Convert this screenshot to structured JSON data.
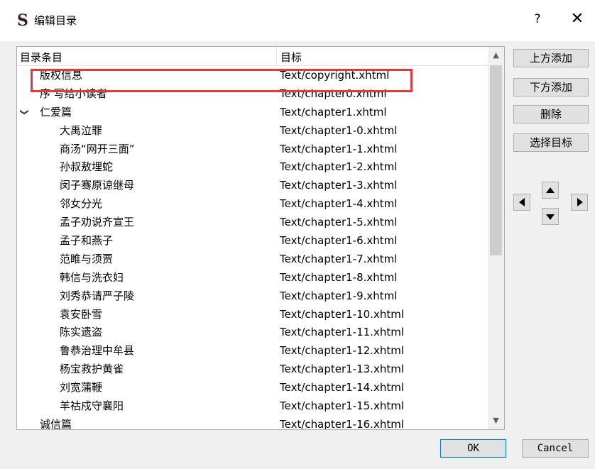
{
  "window": {
    "title": "编辑目录",
    "app_icon": "S",
    "help_label": "?",
    "close_label": "✕"
  },
  "tree": {
    "columns": [
      "目录条目",
      "目标"
    ],
    "rows": [
      {
        "name": "版权信息",
        "target": "Text/copyright.xhtml",
        "level": 0
      },
      {
        "name": "序 写给小读者",
        "target": "Text/chapter0.xhtml",
        "level": 0
      },
      {
        "name": "仁爱篇",
        "target": "Text/chapter1.xhtml",
        "level": 0,
        "expanded": true
      },
      {
        "name": "大禹泣罪",
        "target": "Text/chapter1-0.xhtml",
        "level": 1
      },
      {
        "name": "商汤“网开三面”",
        "target": "Text/chapter1-1.xhtml",
        "level": 1
      },
      {
        "name": "孙叔敖埋蛇",
        "target": "Text/chapter1-2.xhtml",
        "level": 1
      },
      {
        "name": "闵子骞原谅继母",
        "target": "Text/chapter1-3.xhtml",
        "level": 1
      },
      {
        "name": "邻女分光",
        "target": "Text/chapter1-4.xhtml",
        "level": 1
      },
      {
        "name": "孟子劝说齐宣王",
        "target": "Text/chapter1-5.xhtml",
        "level": 1
      },
      {
        "name": "孟子和燕子",
        "target": "Text/chapter1-6.xhtml",
        "level": 1
      },
      {
        "name": "范睢与须贾",
        "target": "Text/chapter1-7.xhtml",
        "level": 1
      },
      {
        "name": "韩信与洗衣妇",
        "target": "Text/chapter1-8.xhtml",
        "level": 1
      },
      {
        "name": "刘秀恭请严子陵",
        "target": "Text/chapter1-9.xhtml",
        "level": 1
      },
      {
        "name": "袁安卧雪",
        "target": "Text/chapter1-10.xhtml",
        "level": 1
      },
      {
        "name": "陈实遗盗",
        "target": "Text/chapter1-11.xhtml",
        "level": 1
      },
      {
        "name": "鲁恭治理中牟县",
        "target": "Text/chapter1-12.xhtml",
        "level": 1
      },
      {
        "name": "杨宝救护黄雀",
        "target": "Text/chapter1-13.xhtml",
        "level": 1
      },
      {
        "name": "刘宽蒲鞭",
        "target": "Text/chapter1-14.xhtml",
        "level": 1
      },
      {
        "name": "羊祜戍守襄阳",
        "target": "Text/chapter1-15.xhtml",
        "level": 1
      },
      {
        "name": "诚信篇",
        "target": "Text/chapter1-16.xhtml",
        "level": 0
      }
    ]
  },
  "side_buttons": {
    "add_above": "上方添加",
    "add_below": "下方添加",
    "delete": "删除",
    "select_target": "选择目标"
  },
  "footer": {
    "ok": "OK",
    "cancel": "Cancel"
  },
  "highlight_color": "#e23a3a"
}
